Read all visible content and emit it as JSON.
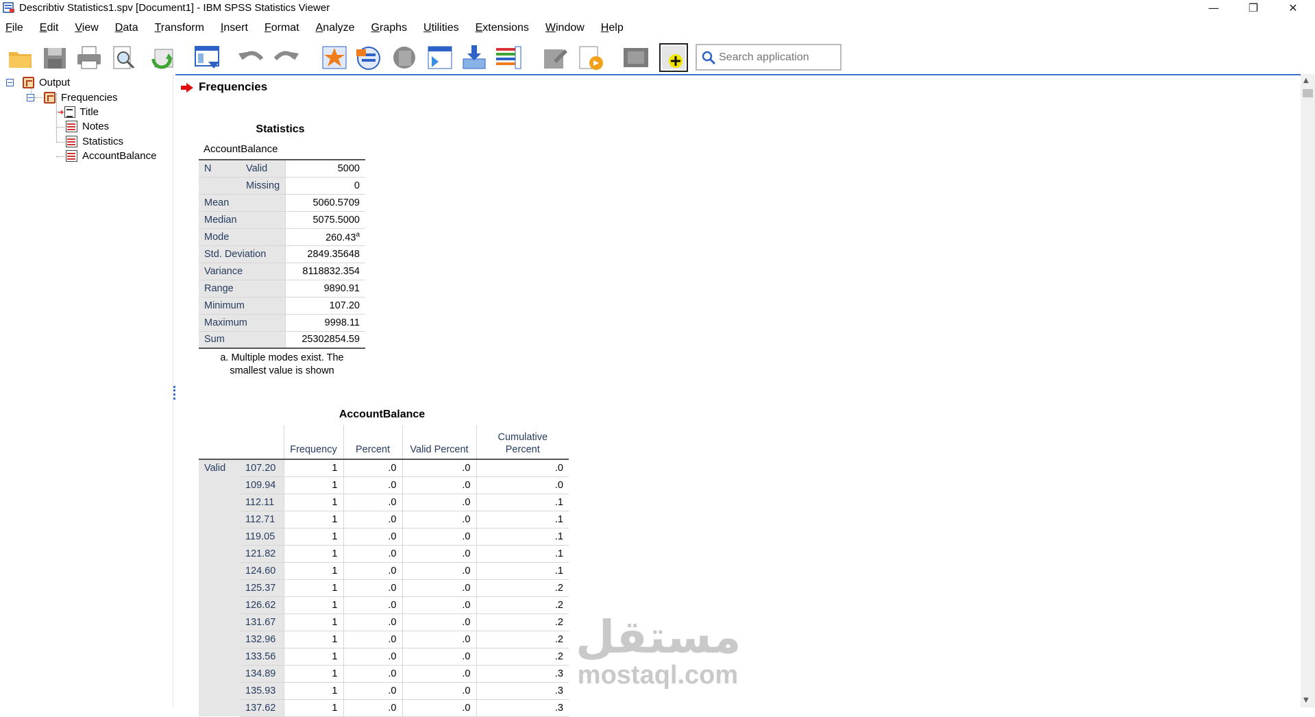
{
  "window": {
    "title": "Describtiv Statistics1.spv [Document1] - IBM SPSS Statistics Viewer",
    "minimize": "—",
    "restore": "❐",
    "close": "✕"
  },
  "menu": [
    {
      "label": "File"
    },
    {
      "label": "Edit"
    },
    {
      "label": "View"
    },
    {
      "label": "Data"
    },
    {
      "label": "Transform"
    },
    {
      "label": "Insert"
    },
    {
      "label": "Format"
    },
    {
      "label": "Analyze"
    },
    {
      "label": "Graphs"
    },
    {
      "label": "Utilities"
    },
    {
      "label": "Extensions"
    },
    {
      "label": "Window"
    },
    {
      "label": "Help"
    }
  ],
  "toolbar": {
    "search_placeholder": "Search application",
    "icons": [
      "open-folder-icon",
      "save-icon",
      "print-icon",
      "print-preview-icon",
      "recall-dialog-icon",
      "goto-data-icon",
      "undo-icon",
      "redo-icon",
      "goto-case-icon",
      "variables-icon",
      "use-sets-icon",
      "designate-window-icon",
      "insert-output-icon",
      "split-icon",
      "show-all-icon",
      "hide-icon",
      "create-chart-icon",
      "show-output-icon",
      "new-output-icon"
    ]
  },
  "tree": {
    "output": "Output",
    "frequencies": "Frequencies",
    "title": "Title",
    "notes": "Notes",
    "statistics": "Statistics",
    "accountbalance": "AccountBalance"
  },
  "output": {
    "heading": "Frequencies",
    "stats_table": {
      "title": "Statistics",
      "variable": "AccountBalance",
      "rows": [
        {
          "group": "N",
          "label": "Valid",
          "value": "5000"
        },
        {
          "group": "",
          "label": "Missing",
          "value": "0"
        },
        {
          "group": "Mean",
          "label": "",
          "value": "5060.5709"
        },
        {
          "group": "Median",
          "label": "",
          "value": "5075.5000"
        },
        {
          "group": "Mode",
          "label": "",
          "value": "260.43",
          "sup": "a"
        },
        {
          "group": "Std. Deviation",
          "label": "",
          "value": "2849.35648"
        },
        {
          "group": "Variance",
          "label": "",
          "value": "8118832.354"
        },
        {
          "group": "Range",
          "label": "",
          "value": "9890.91"
        },
        {
          "group": "Minimum",
          "label": "",
          "value": "107.20"
        },
        {
          "group": "Maximum",
          "label": "",
          "value": "9998.11"
        },
        {
          "group": "Sum",
          "label": "",
          "value": "25302854.59"
        }
      ],
      "footnote_line1": "a. Multiple modes exist. The",
      "footnote_line2": "smallest value is shown"
    },
    "freq_table": {
      "title": "AccountBalance",
      "headers": {
        "frequency": "Frequency",
        "percent": "Percent",
        "valid_percent": "Valid Percent",
        "cumulative_line1": "Cumulative",
        "cumulative_line2": "Percent"
      },
      "valid_label": "Valid",
      "rows": [
        {
          "value": "107.20",
          "frequency": "1",
          "percent": ".0",
          "valid_percent": ".0",
          "cumulative": ".0"
        },
        {
          "value": "109.94",
          "frequency": "1",
          "percent": ".0",
          "valid_percent": ".0",
          "cumulative": ".0"
        },
        {
          "value": "112.11",
          "frequency": "1",
          "percent": ".0",
          "valid_percent": ".0",
          "cumulative": ".1"
        },
        {
          "value": "112.71",
          "frequency": "1",
          "percent": ".0",
          "valid_percent": ".0",
          "cumulative": ".1"
        },
        {
          "value": "119.05",
          "frequency": "1",
          "percent": ".0",
          "valid_percent": ".0",
          "cumulative": ".1"
        },
        {
          "value": "121.82",
          "frequency": "1",
          "percent": ".0",
          "valid_percent": ".0",
          "cumulative": ".1"
        },
        {
          "value": "124.60",
          "frequency": "1",
          "percent": ".0",
          "valid_percent": ".0",
          "cumulative": ".1"
        },
        {
          "value": "125.37",
          "frequency": "1",
          "percent": ".0",
          "valid_percent": ".0",
          "cumulative": ".2"
        },
        {
          "value": "126.62",
          "frequency": "1",
          "percent": ".0",
          "valid_percent": ".0",
          "cumulative": ".2"
        },
        {
          "value": "131.67",
          "frequency": "1",
          "percent": ".0",
          "valid_percent": ".0",
          "cumulative": ".2"
        },
        {
          "value": "132.96",
          "frequency": "1",
          "percent": ".0",
          "valid_percent": ".0",
          "cumulative": ".2"
        },
        {
          "value": "133.56",
          "frequency": "1",
          "percent": ".0",
          "valid_percent": ".0",
          "cumulative": ".2"
        },
        {
          "value": "134.89",
          "frequency": "1",
          "percent": ".0",
          "valid_percent": ".0",
          "cumulative": ".3"
        },
        {
          "value": "135.93",
          "frequency": "1",
          "percent": ".0",
          "valid_percent": ".0",
          "cumulative": ".3"
        },
        {
          "value": "137.62",
          "frequency": "1",
          "percent": ".0",
          "valid_percent": ".0",
          "cumulative": ".3"
        }
      ]
    }
  },
  "watermark": {
    "arabic": "مستقل",
    "latin": "mostaql.com"
  }
}
